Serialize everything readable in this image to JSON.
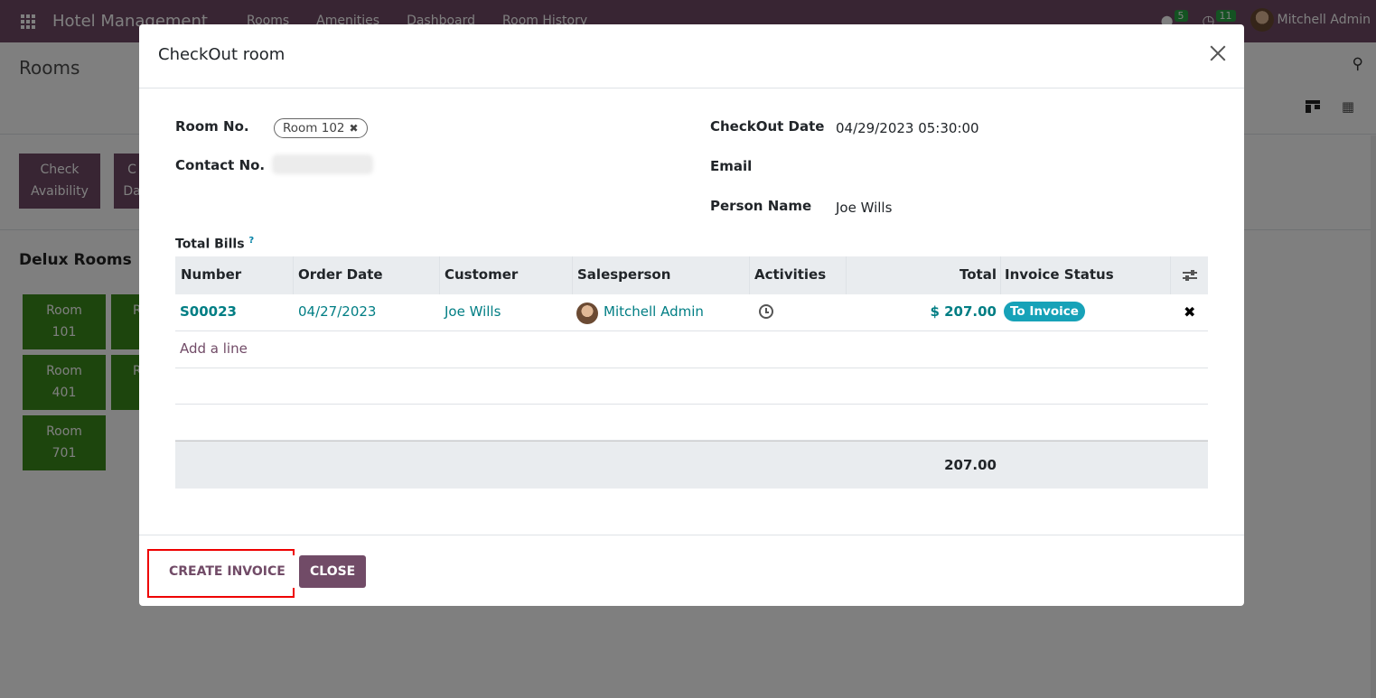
{
  "navbar": {
    "app_name": "Hotel Management",
    "menu": [
      "Rooms",
      "Amenities",
      "Dashboard",
      "Room History"
    ],
    "messages_count": "5",
    "activities_count": "11",
    "user_name": "Mitchell Admin"
  },
  "control_panel": {
    "title": "Rooms"
  },
  "buttons": {
    "check_availability": [
      "Check",
      "Avaibility"
    ],
    "second_partial": [
      "C",
      "Da"
    ]
  },
  "section": {
    "title": "Delux Rooms"
  },
  "rooms": [
    {
      "line1": "Room",
      "line2": "101"
    },
    {
      "line1": "Room",
      "line2": "401"
    },
    {
      "line1": "Room",
      "line2": "701"
    },
    {
      "line1": "R",
      "line2": ""
    },
    {
      "line1": "R",
      "line2": ""
    }
  ],
  "modal": {
    "title": "CheckOut room",
    "fields": {
      "room_no_label": "Room No.",
      "room_no_value": "Room 102",
      "contact_label": "Contact No.",
      "checkout_date_label": "CheckOut Date",
      "checkout_date_value": "04/29/2023 05:30:00",
      "email_label": "Email",
      "email_value": "",
      "person_name_label": "Person Name",
      "person_name_value": "Joe Wills"
    },
    "bills": {
      "label": "Total Bills",
      "help": "?",
      "columns": [
        "Number",
        "Order Date",
        "Customer",
        "Salesperson",
        "Activities",
        "Total",
        "Invoice Status"
      ],
      "rows": [
        {
          "number": "S00023",
          "order_date": "04/27/2023",
          "customer": "Joe Wills",
          "salesperson": "Mitchell Admin",
          "total": "$ 207.00",
          "invoice_status": "To Invoice"
        }
      ],
      "add_line": "Add a line",
      "sum_total": "207.00"
    },
    "footer": {
      "create_invoice": "CREATE INVOICE",
      "close": "CLOSE"
    }
  },
  "colors": {
    "brand": "#714B67",
    "link": "#017e84",
    "room_tile": "#3a8a1a",
    "status_badge": "#17a2b8",
    "highlight": "#e00000"
  }
}
